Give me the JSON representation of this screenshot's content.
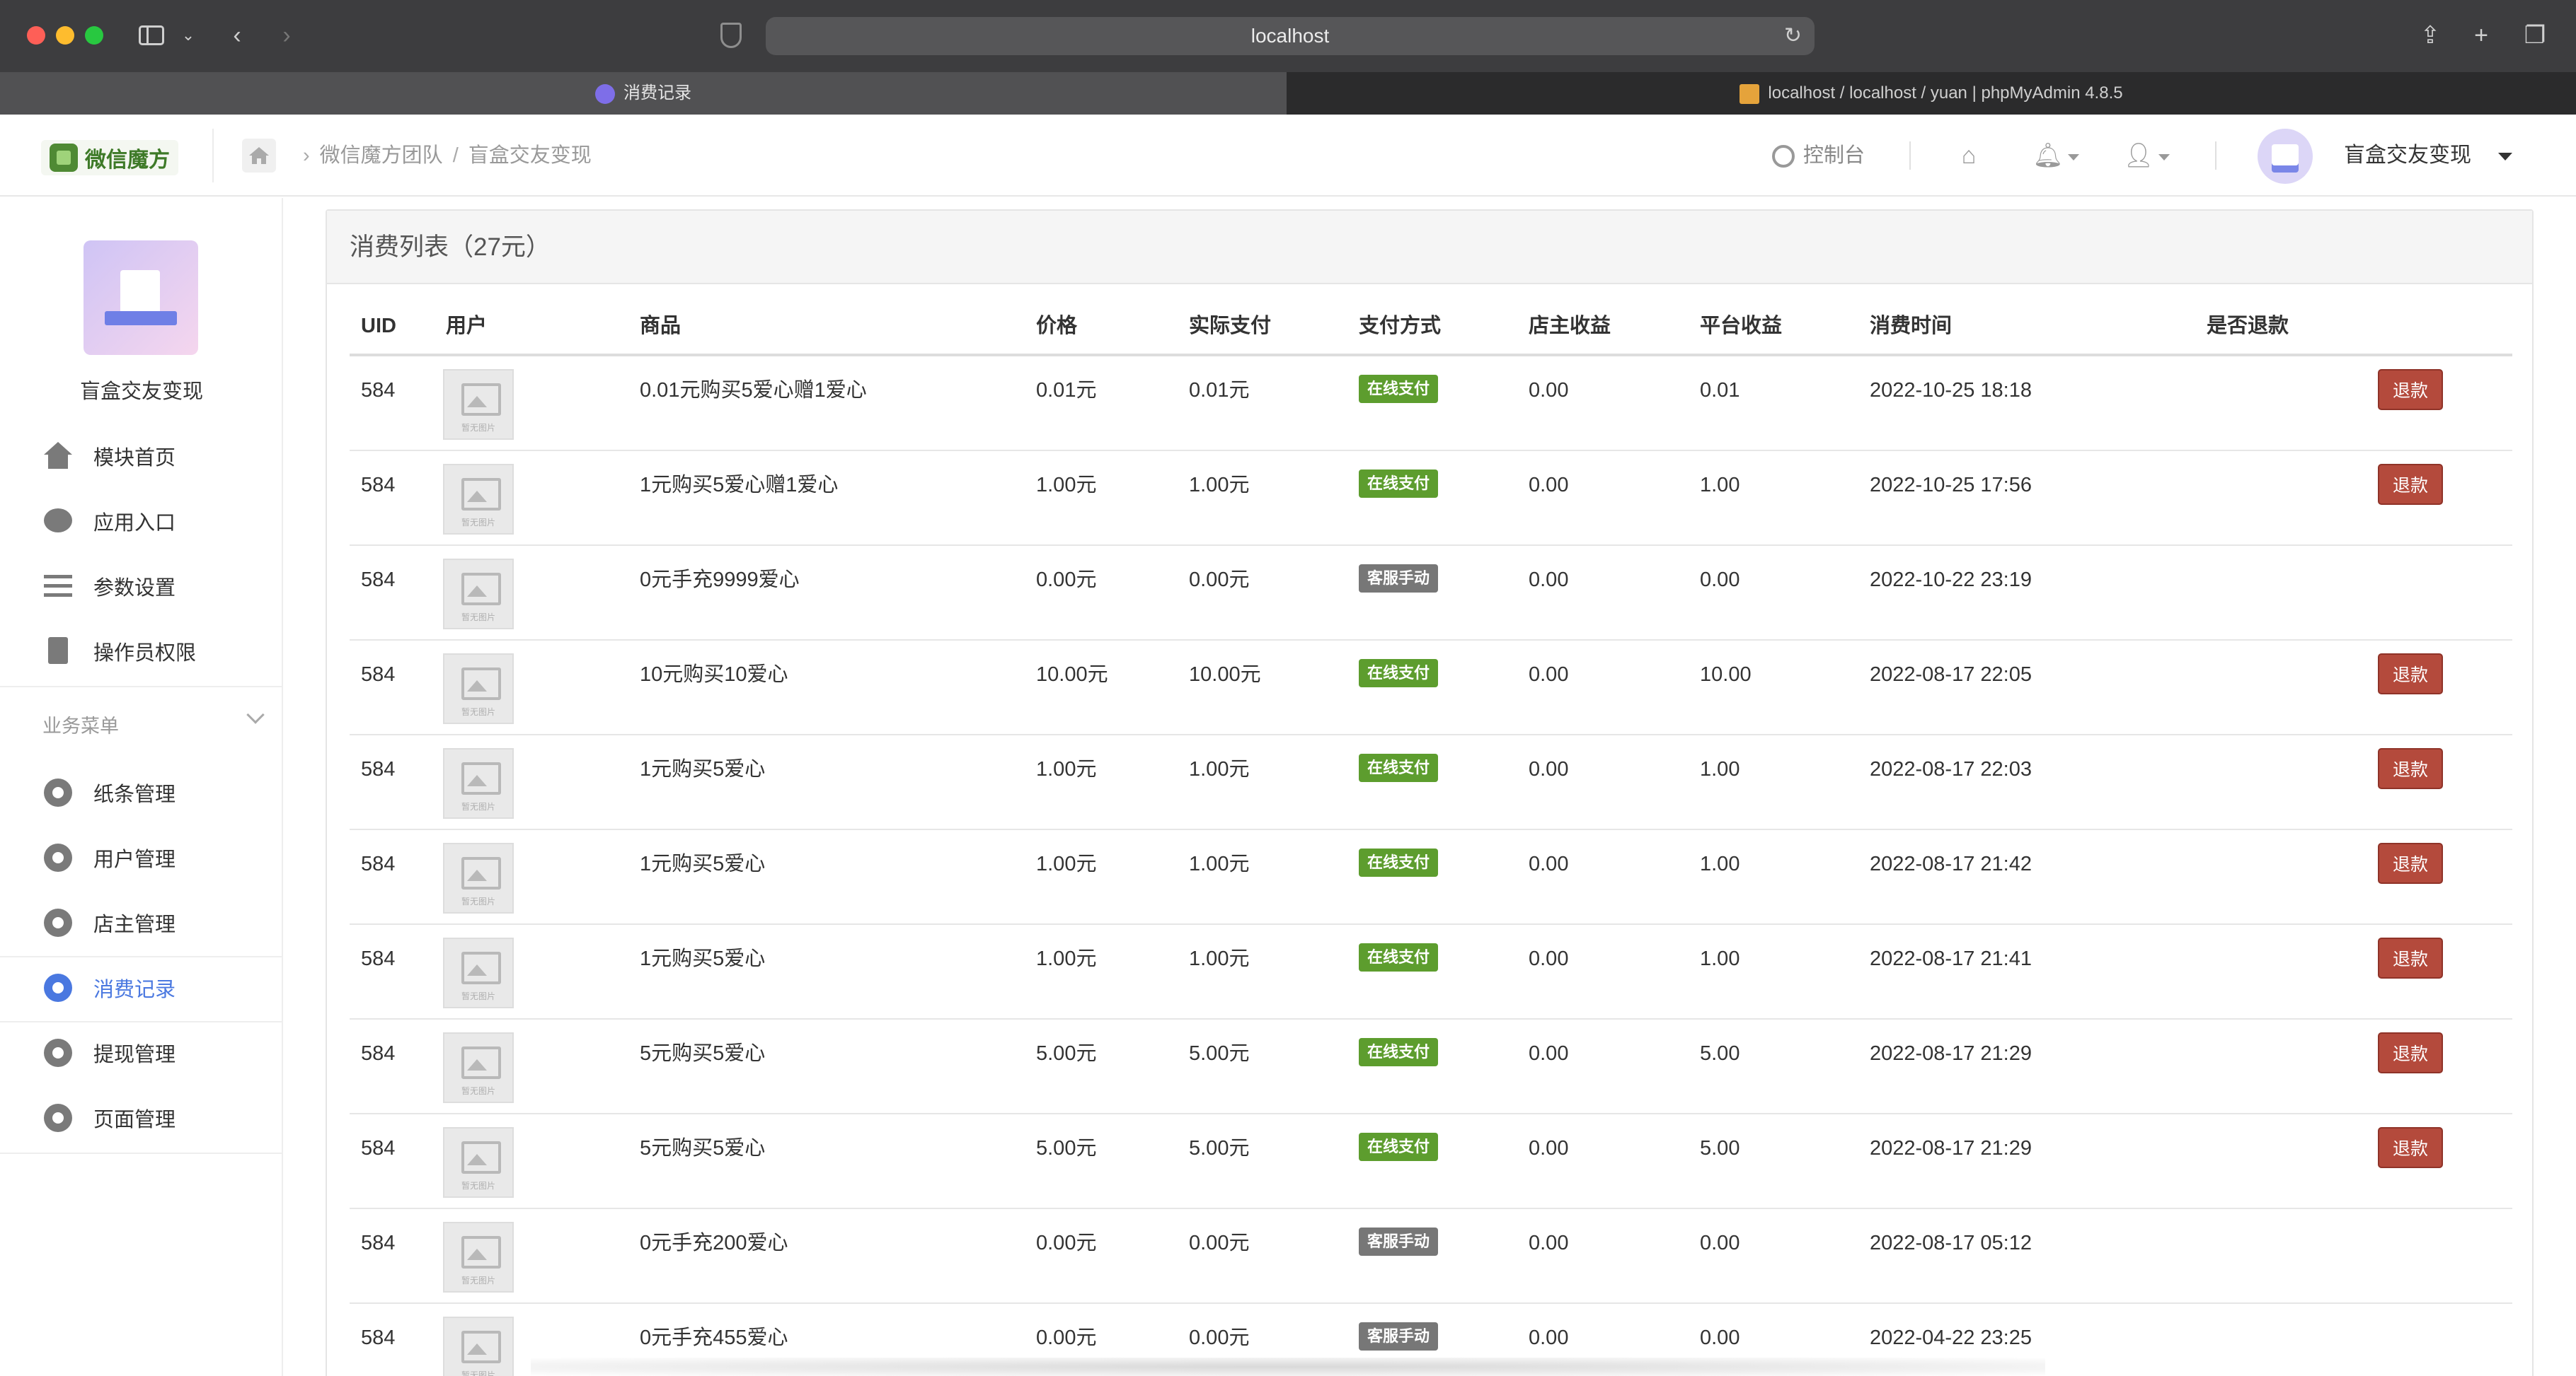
{
  "browser": {
    "url": "localhost",
    "tabs": [
      {
        "label": "消费记录",
        "active": true
      },
      {
        "label": "localhost / localhost / yuan | phpMyAdmin 4.8.5",
        "active": false
      }
    ]
  },
  "header": {
    "logo_text": "微信魔方",
    "breadcrumb": [
      "微信魔方团队",
      "盲盒交友变现"
    ],
    "console_label": "控制台",
    "user_name": "盲盒交友变现"
  },
  "sidebar": {
    "account_name": "盲盒交友变现",
    "items": [
      {
        "label": "模块首页",
        "icon": "home-icon"
      },
      {
        "label": "应用入口",
        "icon": "chat-icon"
      },
      {
        "label": "参数设置",
        "icon": "list-icon"
      },
      {
        "label": "操作员权限",
        "icon": "document-icon"
      }
    ],
    "section_label": "业务菜单",
    "business_items": [
      {
        "label": "纸条管理",
        "active": false
      },
      {
        "label": "用户管理",
        "active": false
      },
      {
        "label": "店主管理",
        "active": false
      },
      {
        "label": "消费记录",
        "active": true
      },
      {
        "label": "提现管理",
        "active": false
      },
      {
        "label": "页面管理",
        "active": false
      }
    ]
  },
  "main": {
    "panel_title": "消费列表（27元）",
    "columns": [
      "UID",
      "用户",
      "商品",
      "价格",
      "实际支付",
      "支付方式",
      "店主收益",
      "平台收益",
      "消费时间",
      "是否退款"
    ],
    "thumb_caption": "暂无图片",
    "refund_label": "退款",
    "rows": [
      {
        "uid": "584",
        "product": "0.01元购买5爱心赠1爱心",
        "price": "0.01元",
        "paid": "0.01元",
        "method": "在线支付",
        "method_type": "online",
        "owner_income": "0.00",
        "platform_income": "0.01",
        "time": "2022-10-25 18:18",
        "refundable": true
      },
      {
        "uid": "584",
        "product": "1元购买5爱心赠1爱心",
        "price": "1.00元",
        "paid": "1.00元",
        "method": "在线支付",
        "method_type": "online",
        "owner_income": "0.00",
        "platform_income": "1.00",
        "time": "2022-10-25 17:56",
        "refundable": true
      },
      {
        "uid": "584",
        "product": "0元手充9999爱心",
        "price": "0.00元",
        "paid": "0.00元",
        "method": "客服手动",
        "method_type": "manual",
        "owner_income": "0.00",
        "platform_income": "0.00",
        "time": "2022-10-22 23:19",
        "refundable": false
      },
      {
        "uid": "584",
        "product": "10元购买10爱心",
        "price": "10.00元",
        "paid": "10.00元",
        "method": "在线支付",
        "method_type": "online",
        "owner_income": "0.00",
        "platform_income": "10.00",
        "time": "2022-08-17 22:05",
        "refundable": true
      },
      {
        "uid": "584",
        "product": "1元购买5爱心",
        "price": "1.00元",
        "paid": "1.00元",
        "method": "在线支付",
        "method_type": "online",
        "owner_income": "0.00",
        "platform_income": "1.00",
        "time": "2022-08-17 22:03",
        "refundable": true
      },
      {
        "uid": "584",
        "product": "1元购买5爱心",
        "price": "1.00元",
        "paid": "1.00元",
        "method": "在线支付",
        "method_type": "online",
        "owner_income": "0.00",
        "platform_income": "1.00",
        "time": "2022-08-17 21:42",
        "refundable": true
      },
      {
        "uid": "584",
        "product": "1元购买5爱心",
        "price": "1.00元",
        "paid": "1.00元",
        "method": "在线支付",
        "method_type": "online",
        "owner_income": "0.00",
        "platform_income": "1.00",
        "time": "2022-08-17 21:41",
        "refundable": true
      },
      {
        "uid": "584",
        "product": "5元购买5爱心",
        "price": "5.00元",
        "paid": "5.00元",
        "method": "在线支付",
        "method_type": "online",
        "owner_income": "0.00",
        "platform_income": "5.00",
        "time": "2022-08-17 21:29",
        "refundable": true
      },
      {
        "uid": "584",
        "product": "5元购买5爱心",
        "price": "5.00元",
        "paid": "5.00元",
        "method": "在线支付",
        "method_type": "online",
        "owner_income": "0.00",
        "platform_income": "5.00",
        "time": "2022-08-17 21:29",
        "refundable": true
      },
      {
        "uid": "584",
        "product": "0元手充200爱心",
        "price": "0.00元",
        "paid": "0.00元",
        "method": "客服手动",
        "method_type": "manual",
        "owner_income": "0.00",
        "platform_income": "0.00",
        "time": "2022-08-17 05:12",
        "refundable": false
      },
      {
        "uid": "584",
        "product": "0元手充455爱心",
        "price": "0.00元",
        "paid": "0.00元",
        "method": "客服手动",
        "method_type": "manual",
        "owner_income": "0.00",
        "platform_income": "0.00",
        "time": "2022-04-22 23:25",
        "refundable": false
      }
    ]
  },
  "colors": {
    "online_badge": "#5d9d2e",
    "manual_badge": "#777777",
    "refund_button": "#b44a3c",
    "active_menu": "#4a78e0"
  }
}
